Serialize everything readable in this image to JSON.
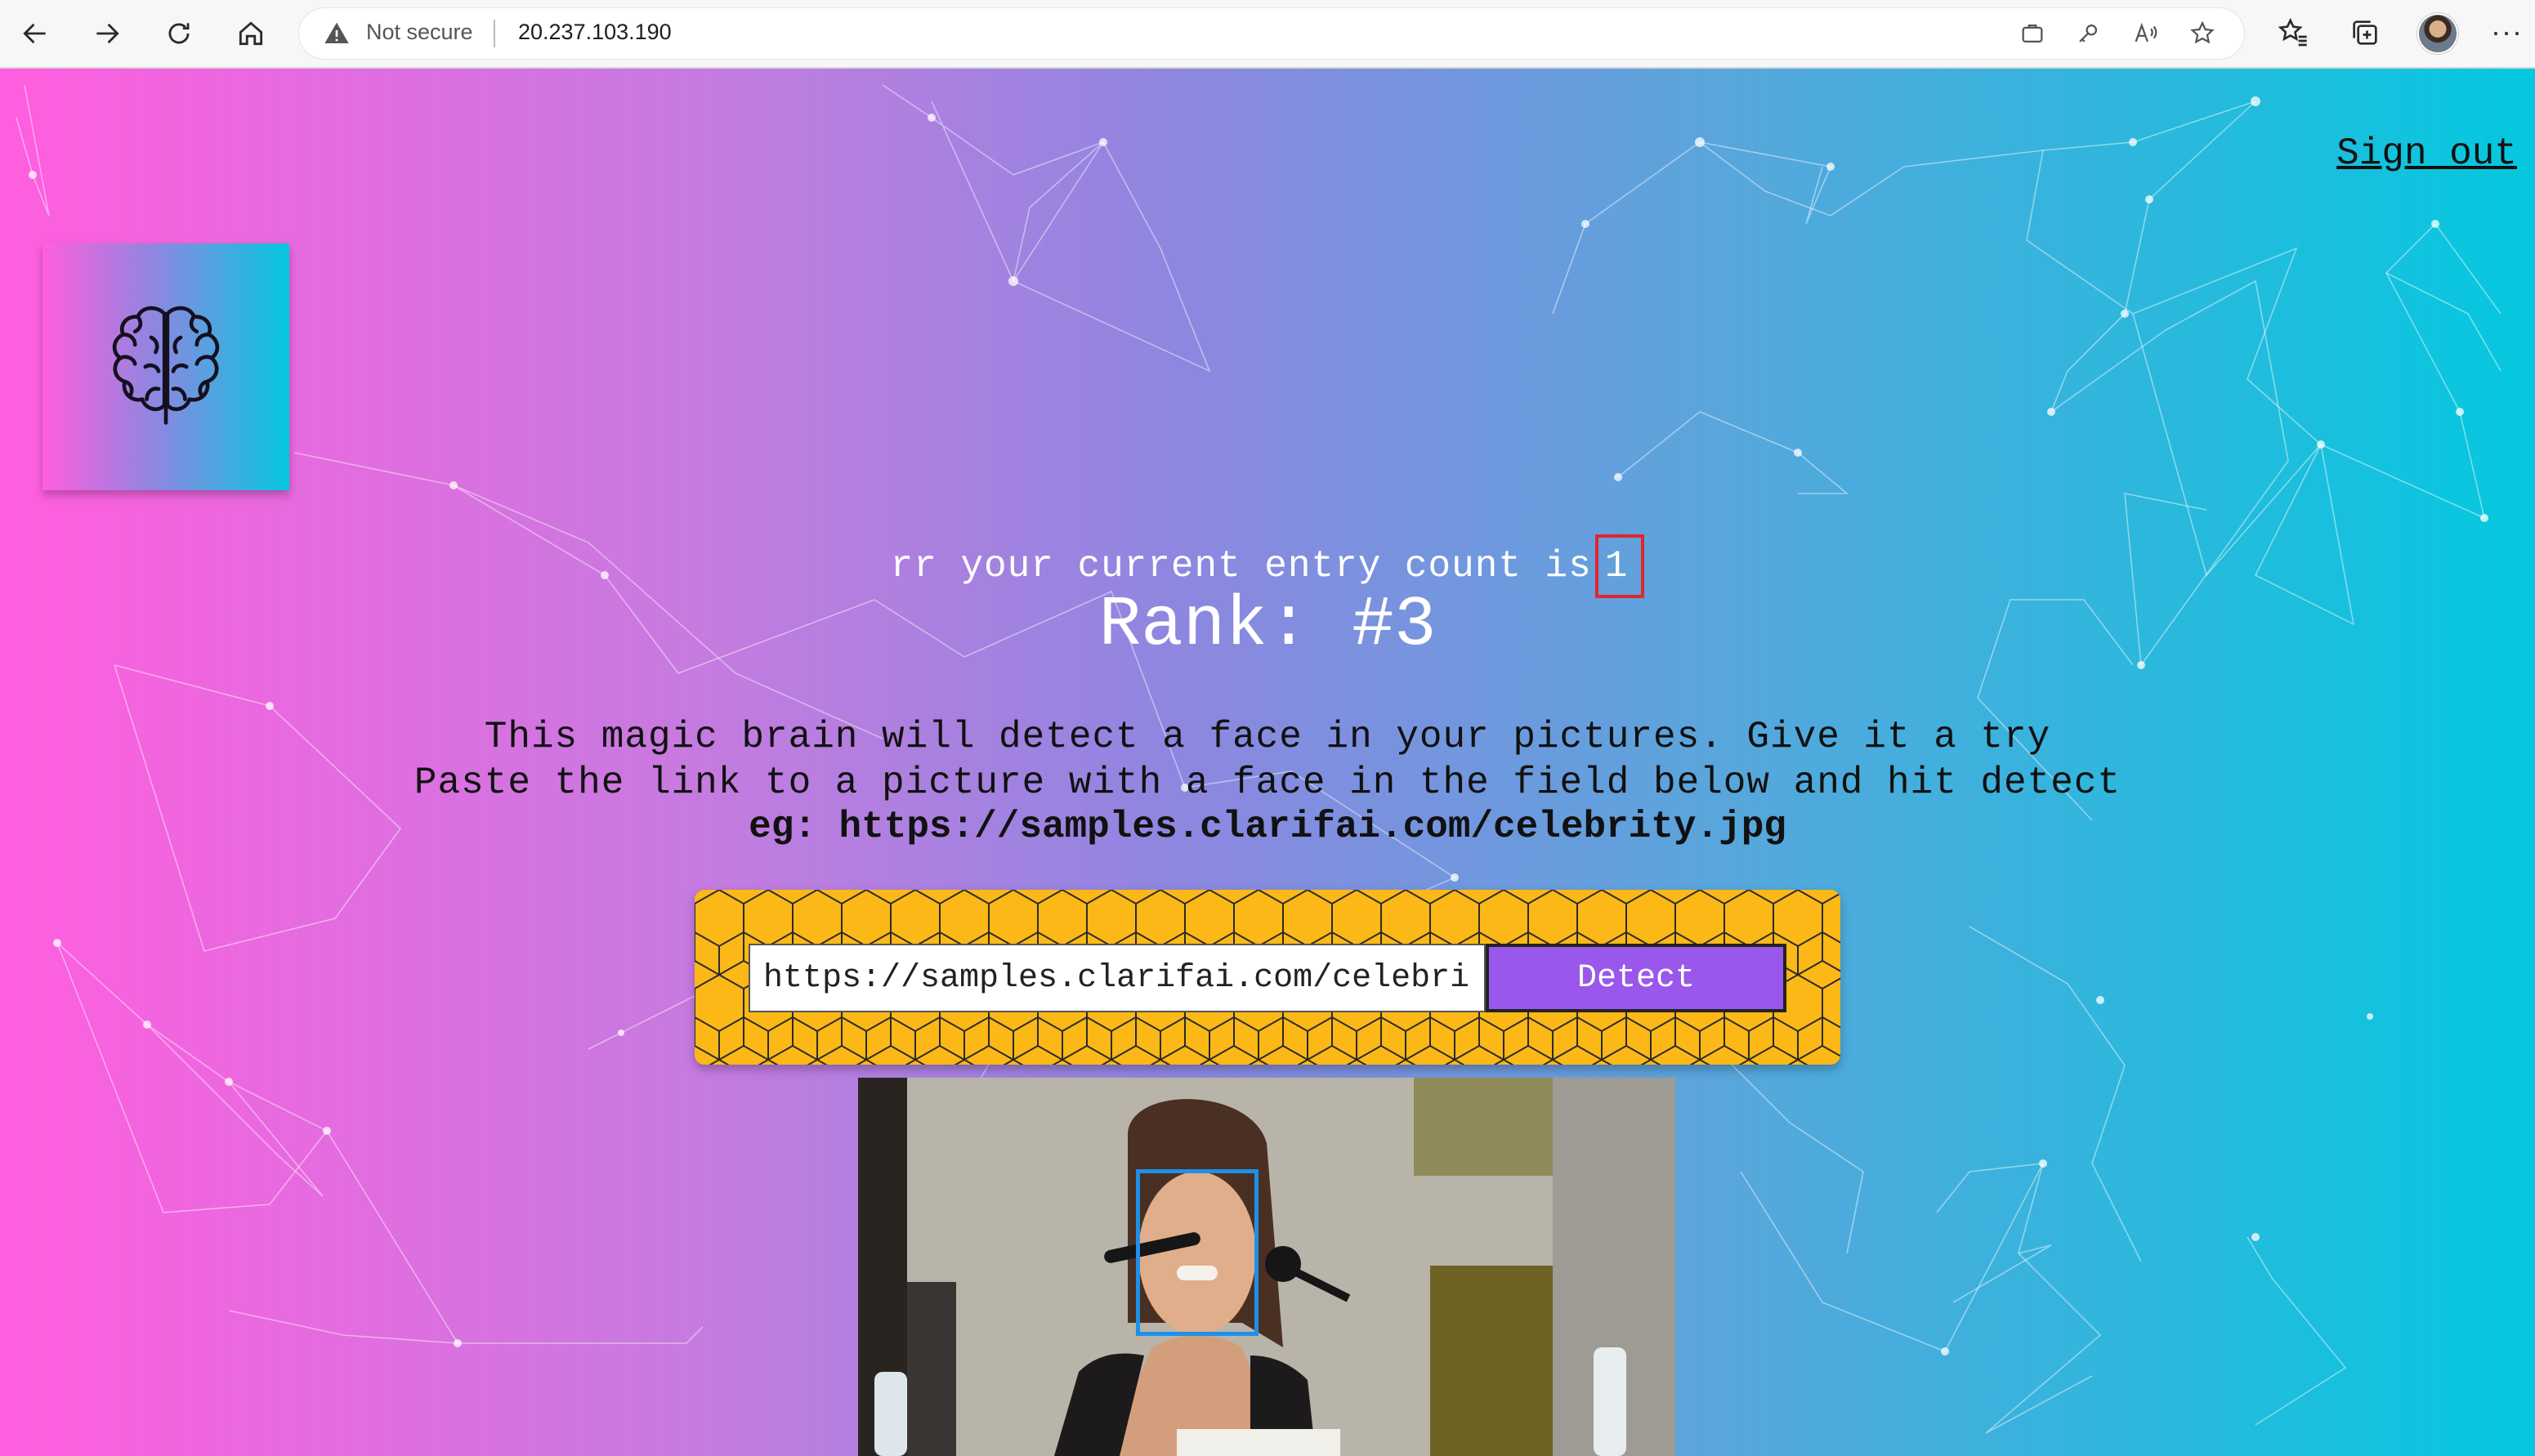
{
  "browser": {
    "security_label": "Not secure",
    "url": "20.237.103.190",
    "accent_color": "#2b2b2b"
  },
  "page": {
    "sign_out_label": "Sign out",
    "greeting_text": "rr your current entry count is",
    "entry_count": "1",
    "rank_text": "Rank: #3",
    "description_line1": "This magic brain will detect a face in your pictures. Give it a try",
    "description_line2": "Paste the link to a picture with a face in the field below and hit detect",
    "example_text": "eg: https://samples.clarifai.com/celebrity.jpg",
    "input_value": "https://samples.clarifai.com/celebrity.jpg",
    "detect_label": "Detect",
    "colors": {
      "gradient_left": "#ff5edf",
      "gradient_right": "#04c8de",
      "detect_button": "#9957ec",
      "form_background": "#fbb816",
      "face_box": "#1f8fe8",
      "count_highlight": "#e0262a"
    }
  },
  "icons": [
    "back-arrow-icon",
    "forward-arrow-icon",
    "refresh-icon",
    "home-icon",
    "warning-icon",
    "brain-icon"
  ]
}
